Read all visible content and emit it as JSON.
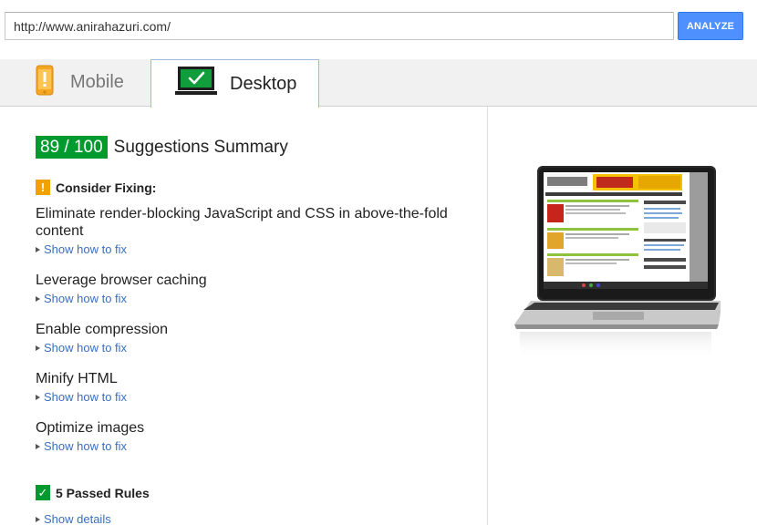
{
  "url_bar": {
    "value": "http://www.anirahazuri.com/",
    "analyze_label": "ANALYZE"
  },
  "tabs": [
    {
      "label": "Mobile",
      "icon": "phone-warning-icon",
      "selected": false
    },
    {
      "label": "Desktop",
      "icon": "monitor-check-icon",
      "selected": true
    }
  ],
  "summary": {
    "score": "89 / 100",
    "title": "Suggestions Summary"
  },
  "consider_fixing": {
    "icon": "!",
    "label": "Consider Fixing:",
    "rules": [
      {
        "title": "Eliminate render-blocking JavaScript and CSS in above-the-fold content",
        "link": "Show how to fix"
      },
      {
        "title": "Leverage browser caching",
        "link": "Show how to fix"
      },
      {
        "title": "Enable compression",
        "link": "Show how to fix"
      },
      {
        "title": "Minify HTML",
        "link": "Show how to fix"
      },
      {
        "title": "Optimize images",
        "link": "Show how to fix"
      }
    ]
  },
  "passed": {
    "icon": "✓",
    "label": "5 Passed Rules",
    "link": "Show details"
  },
  "preview": {
    "icon": "laptop-screenshot-preview"
  },
  "colors": {
    "score_green": "#009a2f",
    "warning_orange": "#f2a100",
    "link_blue": "#3a6fbf",
    "analyze_blue": "#4d90fe"
  }
}
